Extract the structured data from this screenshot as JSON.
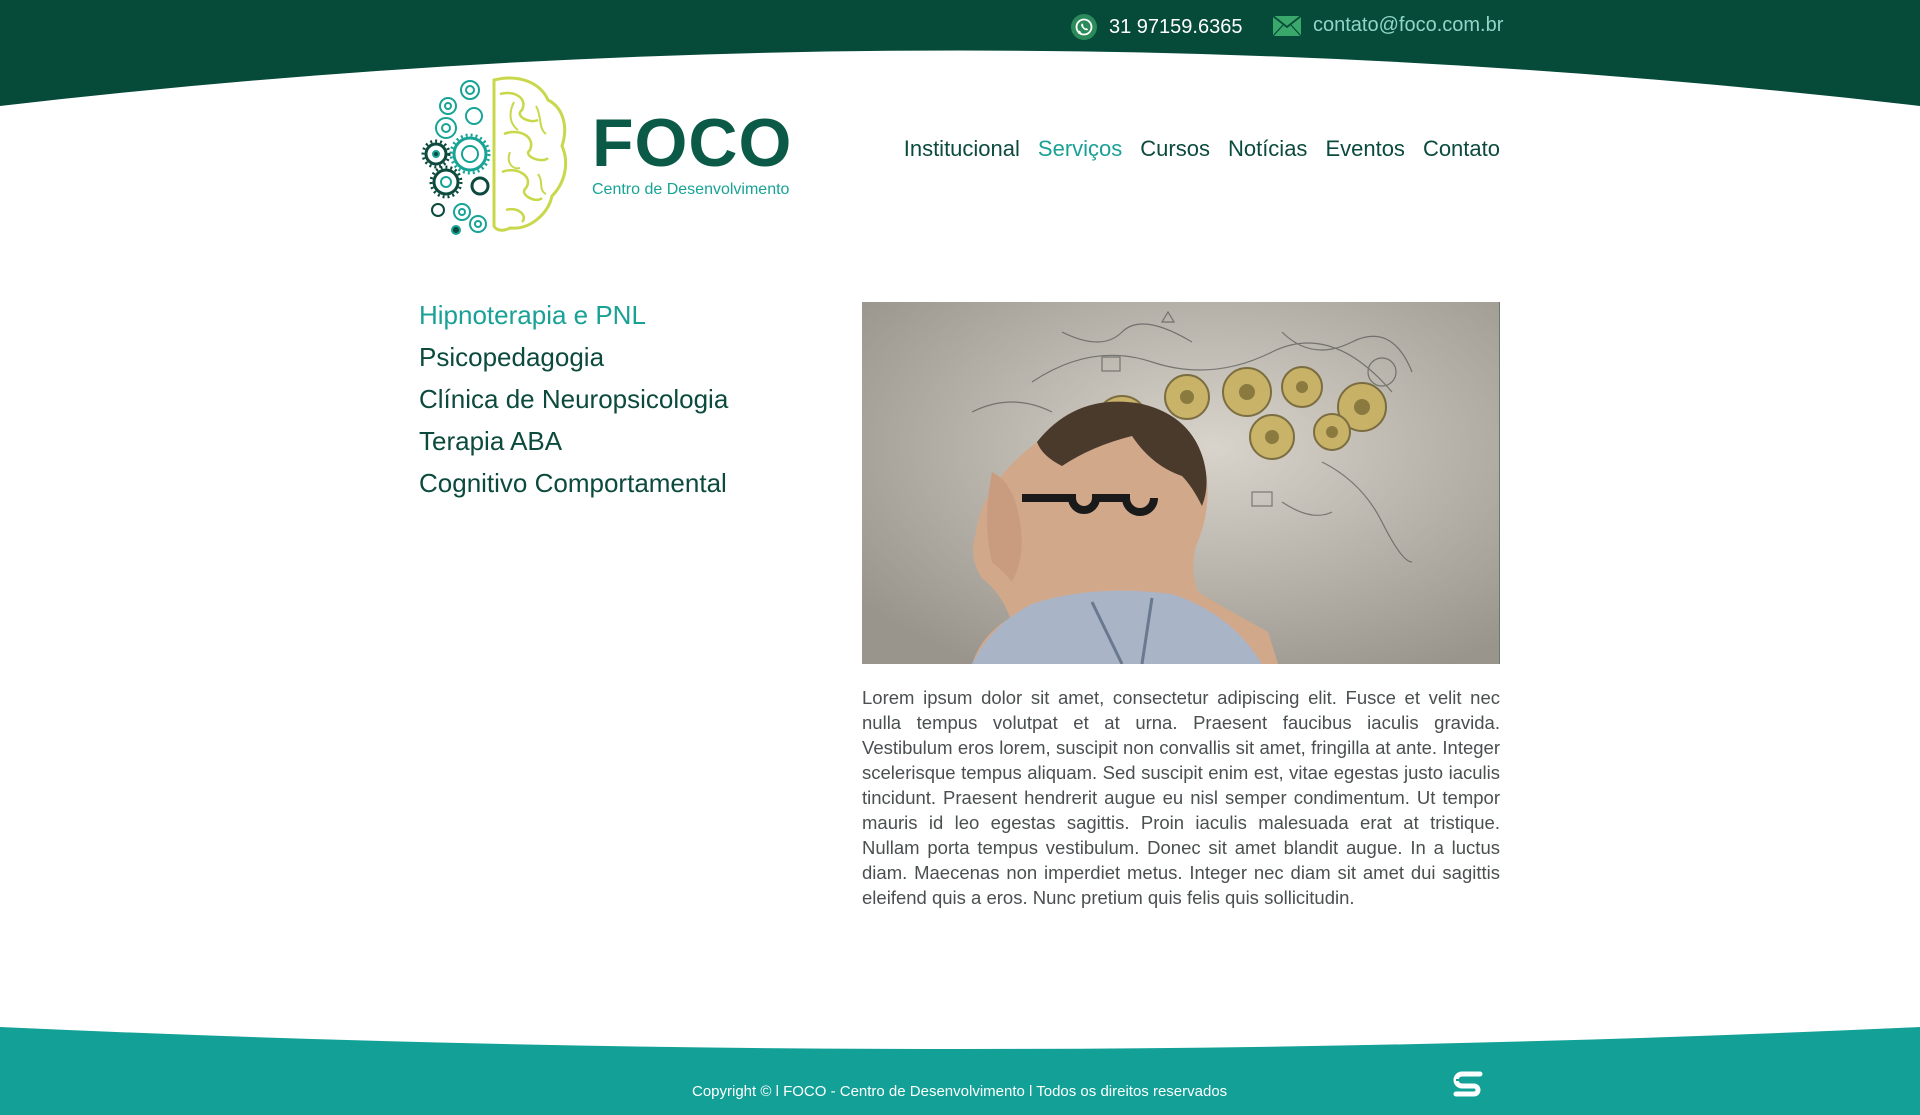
{
  "header": {
    "phone": "31 97159.6365",
    "email": "contato@foco.com.br",
    "phone_icon": "whatsapp-icon",
    "email_icon": "envelope-icon"
  },
  "logo": {
    "title": "FOCO",
    "subtitle": "Centro de Desenvolvimento"
  },
  "nav": {
    "items": [
      {
        "label": "Institucional"
      },
      {
        "label": "Serviços"
      },
      {
        "label": "Cursos"
      },
      {
        "label": "Notícias"
      },
      {
        "label": "Eventos"
      },
      {
        "label": "Contato"
      }
    ],
    "active": "Serviços"
  },
  "services": {
    "items": [
      {
        "label": "Hipnoterapia e PNL"
      },
      {
        "label": "Psicopedagogia"
      },
      {
        "label": "Clínica de Neuropsicologia"
      },
      {
        "label": "Terapia ABA"
      },
      {
        "label": "Cognitivo Comportamental"
      }
    ],
    "active": "Hipnoterapia e PNL"
  },
  "content": {
    "body": "Lorem ipsum dolor sit amet, consectetur adipiscing elit. Fusce et velit nec nulla tempus volutpat et at urna. Praesent faucibus iaculis gravida. Vestibulum eros lorem, suscipit non convallis sit amet, fringilla at ante. Integer scelerisque tempus aliquam. Sed suscipit enim est, vitae egestas justo iaculis tincidunt. Praesent hendrerit augue eu nisl semper condimentum. Ut tempor mauris id leo egestas sagittis. Proin iaculis malesuada erat at tristique. Nullam porta tempus vestibulum. Donec sit amet blandit augue. In a luctus diam. Maecenas non imperdiet metus. Integer nec diam sit amet dui sagittis eleifend quis a eros. Nunc pretium quis felis quis sollicitudin."
  },
  "footer": {
    "copyright": "Copyright © l FOCO - Centro de Desenvolvimento l Todos os direitos reservados"
  },
  "colors": {
    "dark_green": "#0b4a3c",
    "header_band": "#064a3a",
    "accent_teal": "#1aa196",
    "footer_band": "#13a197",
    "logo_lime": "#c8d84a"
  }
}
